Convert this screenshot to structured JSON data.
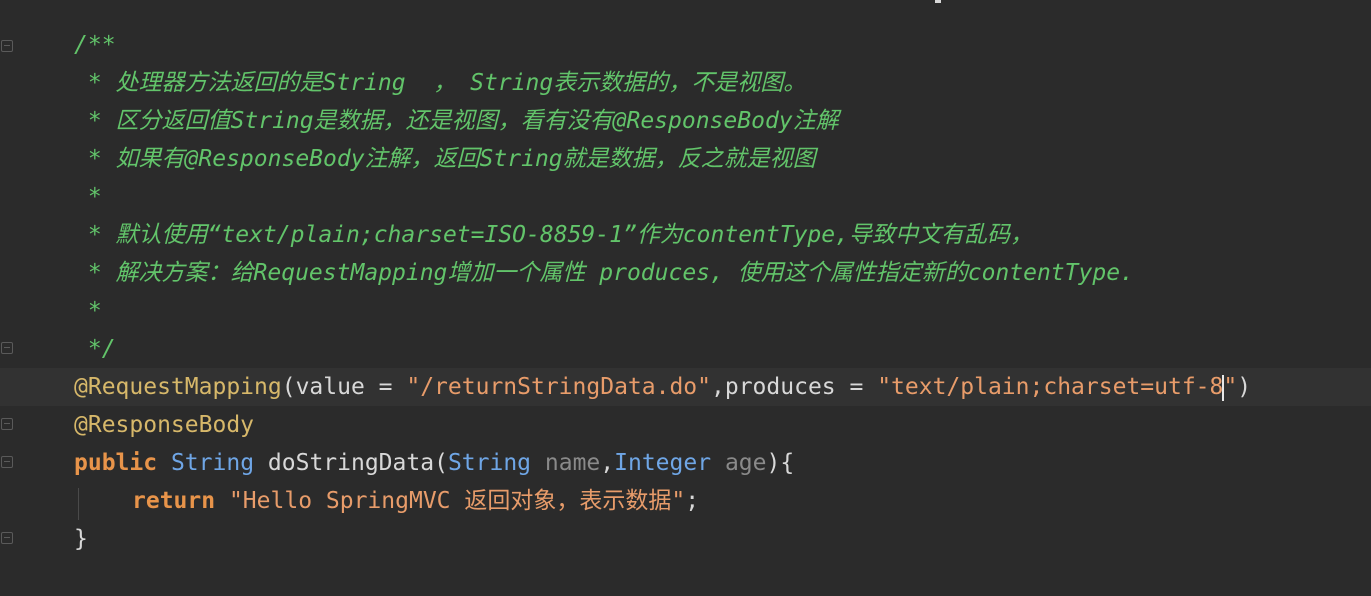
{
  "editor": {
    "comment_lines": [
      "/**",
      " * 处理器方法返回的是String  ， String表示数据的，不是视图。",
      " * 区分返回值String是数据，还是视图，看有没有@ResponseBody注解",
      " * 如果有@ResponseBody注解，返回String就是数据，反之就是视图",
      " *",
      " * 默认使用“text/plain;charset=ISO-8859-1”作为contentType,导致中文有乱码，",
      " * 解决方案：给RequestMapping增加一个属性 produces, 使用这个属性指定新的contentType.",
      " *",
      " */"
    ],
    "annotation1": {
      "name": "@RequestMapping",
      "open": "(",
      "value_key": "value = ",
      "value_str": "\"/returnStringData.do\"",
      "comma": ",",
      "produces_key": "produces = ",
      "produces_str_a": "\"text/plain;charset=utf-8",
      "produces_str_b": "\"",
      "close": ")"
    },
    "annotation2": "@ResponseBody",
    "signature": {
      "kw_public": "public",
      "ret_type": "String",
      "method": "doStringData",
      "open": "(",
      "p1_type": "String",
      "p1_name": "name",
      "comma": ",",
      "p2_type": "Integer",
      "p2_name": "age",
      "close": "){"
    },
    "return_stmt": {
      "kw_return": "return",
      "str": "\"Hello SpringMVC 返回对象，表示数据\"",
      "semi": ";"
    },
    "closing_brace": "}"
  },
  "colors": {
    "background": "#2b2b2b",
    "comment": "#62c46a",
    "annotation": "#d7b86a",
    "keyword": "#e8944a",
    "string": "#e89c6a",
    "type": "#6fa6e6"
  }
}
